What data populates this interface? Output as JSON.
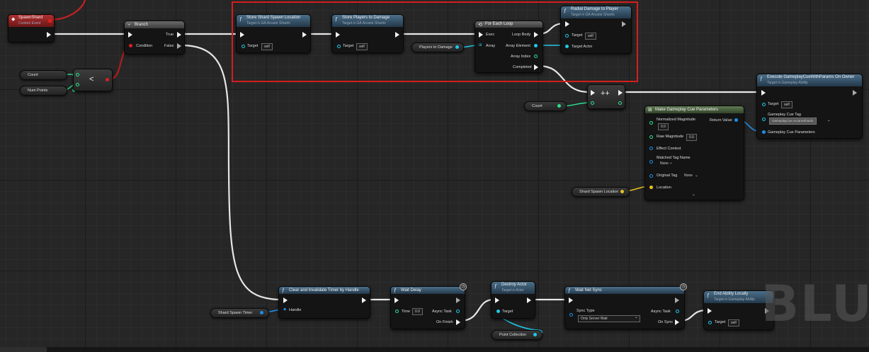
{
  "graph": {
    "watermark": "BLU",
    "colors": {
      "exec": "#f2f2f2",
      "object_pin": "#1ec8e8",
      "integer_pin": "#2ee08e",
      "bool_pin": "#d92020",
      "vector_pin": "#e8c020",
      "struct_pin": "#1e8ee8",
      "selection": "#d41e1e"
    }
  },
  "nodes": {
    "spawn_shard": {
      "title": "SpawnShard",
      "subtitle": "Custom Event"
    },
    "branch": {
      "title": "Branch",
      "true_label": "True",
      "false_label": "False",
      "condition_label": "Condition"
    },
    "store_shard": {
      "title": "Store Shard Spawn Location",
      "subtitle": "Target is GA Arcane Shards",
      "target_label": "Target",
      "target_value": "self"
    },
    "store_players": {
      "title": "Store Players to Damage",
      "subtitle": "Target is GA Arcane Shards",
      "target_label": "Target",
      "target_value": "self"
    },
    "for_each": {
      "title": "For Each Loop",
      "exec_label": "Exec",
      "array_label": "Array",
      "loop_body_label": "Loop Body",
      "array_element_label": "Array Element",
      "array_index_label": "Array Index",
      "completed_label": "Completed"
    },
    "radial": {
      "title": "Radial Damage to Player",
      "subtitle": "Target is GA Arcane Shards",
      "target_label": "Target",
      "target_value": "self",
      "target_actor_label": "Target Actor"
    },
    "increment": {
      "symbol": "++"
    },
    "less": {
      "symbol": "<"
    },
    "execute_cue": {
      "title": "Execute GameplayCueWithParams On Owner",
      "subtitle": "Target is Gameplay Ability",
      "target_label": "Target",
      "target_value": "self",
      "cue_tag_label": "Gameplay Cue Tag",
      "cue_tag_value": "GameplayCue.ArcaneShards",
      "cue_params_label": "Gameplay Cue Parameters"
    },
    "make_params": {
      "title": "Make Gameplay Cue Parameters",
      "normalized_label": "Normalized Magnitude",
      "normalized_value": "0.0",
      "raw_label": "Raw Magnitude",
      "raw_value": "0.0",
      "effect_label": "Effect Context",
      "matched_label": "Matched Tag Name",
      "matched_value": "None",
      "original_label": "Original Tag",
      "original_value": "None",
      "location_label": "Location",
      "return_label": "Return Value"
    },
    "clear_timer": {
      "title": "Clear and Invalidate Timer by Handle",
      "handle_label": "Handle"
    },
    "wait_delay": {
      "title": "Wait Delay",
      "time_label": "Time",
      "time_value": "0.0",
      "async_label": "Async Task",
      "on_finish_label": "On Finish"
    },
    "destroy": {
      "title": "Destroy Actor",
      "subtitle": "Target is Actor",
      "target_label": "Target"
    },
    "wait_net": {
      "title": "Wait Net Sync",
      "sync_label": "Sync Type",
      "sync_value": "Only Server Wait",
      "async_label": "Async Task",
      "on_sync_label": "On Sync"
    },
    "end_ability": {
      "title": "End Ability Locally",
      "subtitle": "Target is Gameplay Ability",
      "target_label": "Target",
      "target_value": "self"
    }
  },
  "variables": {
    "count_a": "Count",
    "num_points": "Num Points",
    "players_to_damage": "Players to Damage",
    "count_b": "Count",
    "shard_spawn_location": "Shard Spawn Location",
    "shard_spawn_timer": "Shard Spawn Timer",
    "point_collection": "Point Collection"
  },
  "icons": {
    "clock": "clock-icon",
    "event": "event-icon",
    "function": "function-icon",
    "loop": "loop-icon"
  }
}
